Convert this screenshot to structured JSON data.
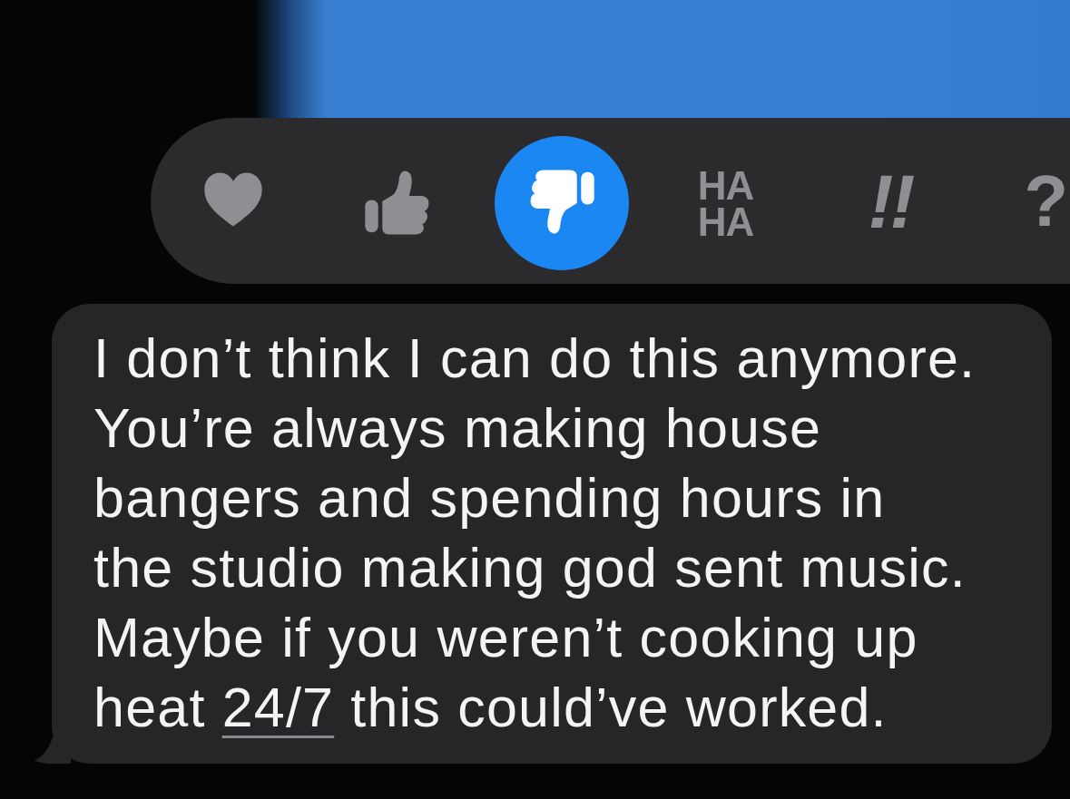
{
  "reaction_bar": {
    "reactions": [
      {
        "kind": "heart",
        "selected": false
      },
      {
        "kind": "thumbs_up",
        "selected": false
      },
      {
        "kind": "thumbs_down",
        "selected": true
      },
      {
        "kind": "haha",
        "text": "HA\nHA",
        "selected": false
      },
      {
        "kind": "emphasis",
        "text": "!!",
        "selected": false
      },
      {
        "kind": "question",
        "text": "?",
        "selected": false
      }
    ]
  },
  "message": {
    "segments": [
      {
        "kind": "text",
        "text": "I don’t think I can do this anymore.\nYou’re always making house\nbangers and spending hours in\nthe studio making god sent music.\nMaybe if you weren’t cooking up\nheat "
      },
      {
        "kind": "link",
        "text": "24/7"
      },
      {
        "kind": "text",
        "text": " this could’ve worked."
      }
    ]
  }
}
